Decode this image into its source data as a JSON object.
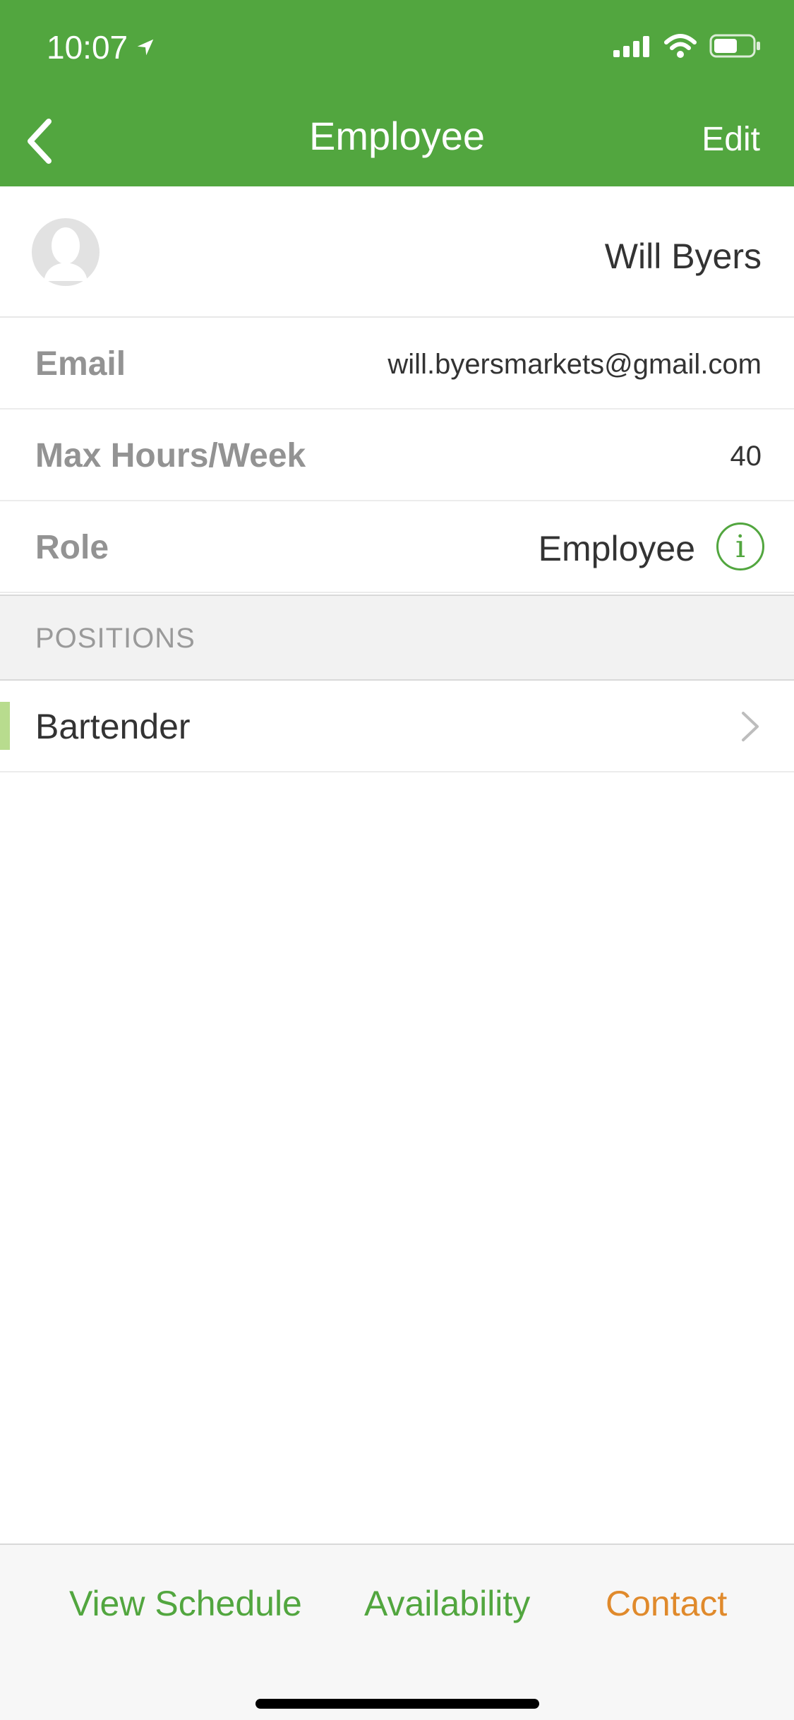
{
  "status_bar": {
    "time": "10:07"
  },
  "nav": {
    "title": "Employee",
    "edit_label": "Edit"
  },
  "profile": {
    "name": "Will Byers"
  },
  "fields": {
    "email_label": "Email",
    "email_value": "will.byersmarkets@gmail.com",
    "hours_label": "Max Hours/Week",
    "hours_value": "40",
    "role_label": "Role",
    "role_value": "Employee"
  },
  "positions": {
    "section_title": "POSITIONS",
    "items": [
      {
        "label": "Bartender",
        "color": "#b8dc8e"
      }
    ]
  },
  "bottom_tabs": {
    "view_schedule": "View Schedule",
    "availability": "Availability",
    "contact": "Contact"
  },
  "colors": {
    "brand_green": "#52a63f",
    "contact_orange": "#e08a2c"
  }
}
